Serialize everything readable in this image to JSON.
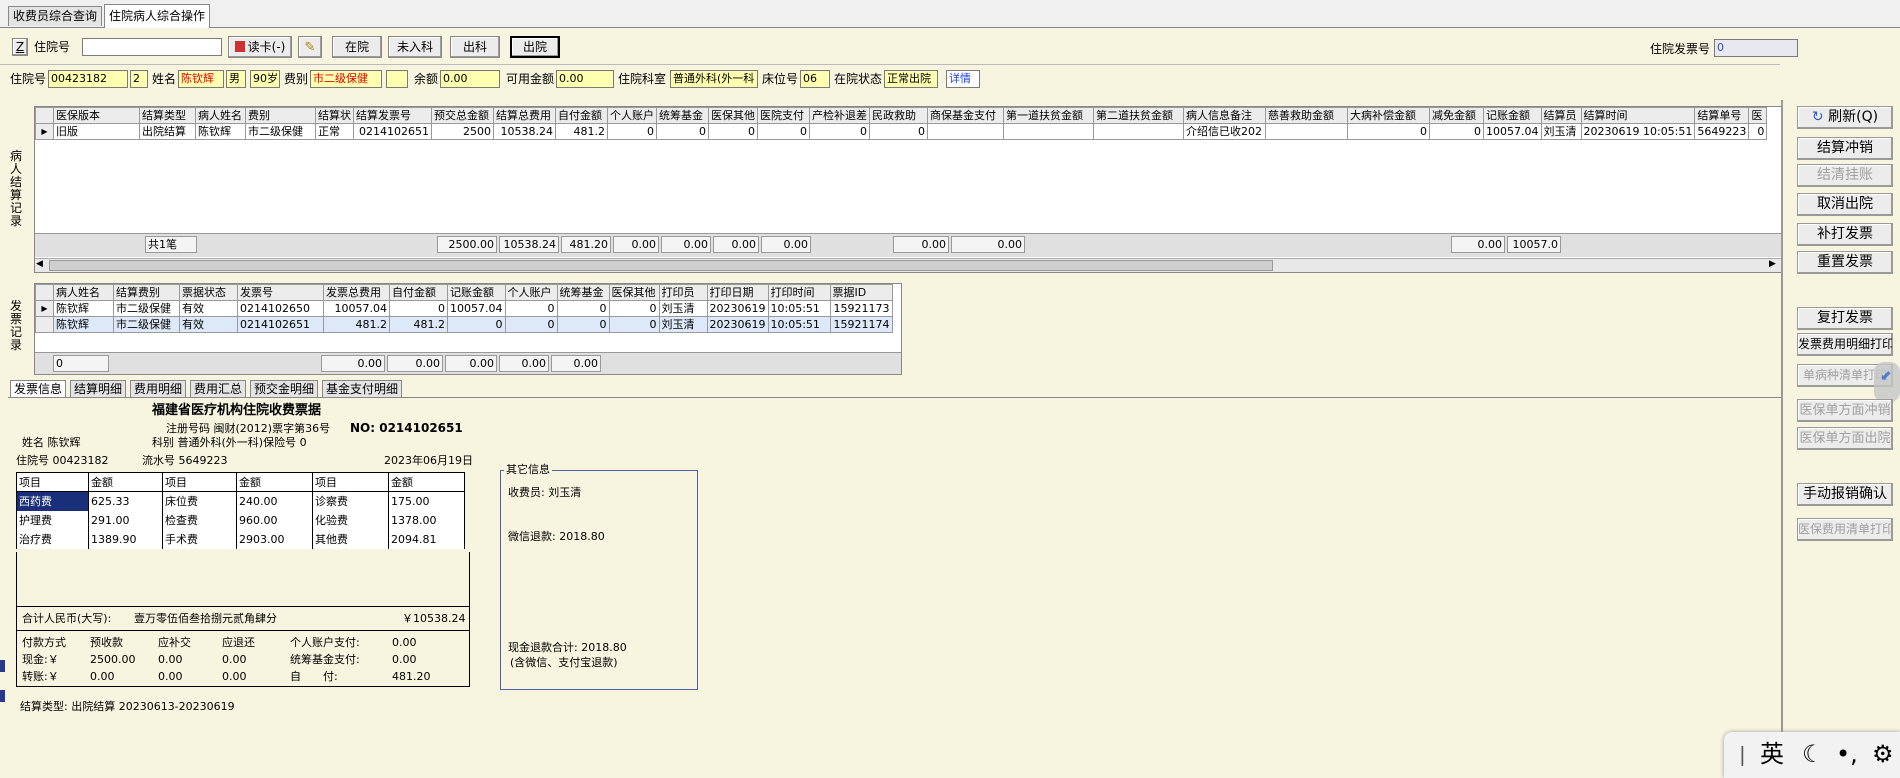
{
  "window_tabs": [
    "收费员综合查询",
    "住院病人综合操作"
  ],
  "search": {
    "toggle": "Z",
    "label": "住院号",
    "value": "",
    "read_card": "读卡(-)",
    "btn_in": "在院",
    "btn_notin": "未入科",
    "btn_out": "出科",
    "btn_discharge": "出院",
    "invoice_label": "住院发票号",
    "invoice_value": "0"
  },
  "patient": {
    "id_label": "住院号",
    "id": "00423182",
    "id_suffix": "2",
    "name_label": "姓名",
    "name": "陈钦辉",
    "sex": "男",
    "age": "90岁",
    "fee_label": "费别",
    "fee_type": "市二级保健",
    "balance_label": "余额",
    "balance": "0.00",
    "avail_label": "可用金额",
    "avail": "0.00",
    "dept_label": "住院科室",
    "dept": "普通外科(外一科",
    "bed_label": "床位号",
    "bed": "06",
    "status_label": "在院状态",
    "status": "正常出院",
    "detail": "详情"
  },
  "settle_label": "病人结算记录",
  "settle_cols": [
    "医保版本",
    "结算类型",
    "病人姓名",
    "费别",
    "结算状",
    "结算发票号",
    "预交总金额",
    "结算总费用",
    "自付金额",
    "个人账户",
    "统筹基金",
    "医保其他",
    "医院支付",
    "产检补退差",
    "民政救助",
    "商保基金支付",
    "第一道扶贫金额",
    "第二道扶贫金额",
    "病人信息备注",
    "慈善救助金额",
    "大病补偿金额",
    "减免金额",
    "记账金额",
    "结算员",
    "结算时间",
    "结算单号",
    "医"
  ],
  "settle_rows": [
    [
      "旧版",
      "出院结算",
      "陈钦辉",
      "市二级保健",
      "正常",
      "0214102651",
      "2500",
      "10538.24",
      "481.2",
      "0",
      "0",
      "0",
      "0",
      "0",
      "0",
      "",
      "",
      "",
      "介绍信已收202",
      "",
      "0",
      "0",
      "10057.04",
      "刘玉清",
      "20230619 10:05:51",
      "5649223",
      "0"
    ]
  ],
  "settle_sum": {
    "count": "共1笔",
    "deposit": "2500.00",
    "total": "10538.24",
    "self": "481.20",
    "personal": "0.00",
    "pooled": "0.00",
    "other": "0.00",
    "hospital": "0.00",
    "civil": "0.00",
    "commercial": "0.00",
    "reduce": "0.00",
    "account": "10057.0"
  },
  "invoice_label": "发票记录",
  "invoice_cols": [
    "病人姓名",
    "结算费别",
    "票据状态",
    "发票号",
    "发票总费用",
    "自付金额",
    "记账金额",
    "个人账户",
    "统筹基金",
    "医保其他",
    "打印员",
    "打印日期",
    "打印时间",
    "票据ID"
  ],
  "invoice_rows": [
    [
      "陈钦辉",
      "市二级保健",
      "有效",
      "0214102650",
      "10057.04",
      "0",
      "10057.04",
      "0",
      "0",
      "0",
      "刘玉清",
      "20230619",
      "10:05:51",
      "15921173"
    ],
    [
      "陈钦辉",
      "市二级保健",
      "有效",
      "0214102651",
      "481.2",
      "481.2",
      "0",
      "0",
      "0",
      "0",
      "刘玉清",
      "20230619",
      "10:05:51",
      "15921174"
    ]
  ],
  "invoice_sum": {
    "count": "0",
    "total": "0.00",
    "self": "0.00",
    "account": "0.00",
    "personal": "0.00",
    "pooled": "0.00"
  },
  "bottom_tabs": [
    "发票信息",
    "结算明细",
    "费用明细",
    "费用汇总",
    "预交金明细",
    "基金支付明细"
  ],
  "receipt": {
    "title": "福建省医疗机构住院收费票据",
    "reg": "注册号码 闽财(2012)票字第36号",
    "no": "NO: 0214102651",
    "name": "姓名 陈钦辉",
    "dept": "科别 普通外科(外一科)保险号 0",
    "inpatient": "住院号 00423182",
    "serial": "流水号 5649223",
    "date": "2023年06月19日",
    "item_head": [
      "项目",
      "金额",
      "项目",
      "金额",
      "项目",
      "金额"
    ],
    "items": [
      [
        "西药费",
        "625.33",
        "床位费",
        "240.00",
        "诊察费",
        "175.00"
      ],
      [
        "护理费",
        "291.00",
        "检查费",
        "960.00",
        "化验费",
        "1378.00"
      ],
      [
        "治疗费",
        "1389.90",
        "手术费",
        "2903.00",
        "其他费",
        "2094.81"
      ]
    ],
    "total_label": "合计人民币(大写):",
    "total_cn": "壹万零伍佰叁拾捌元贰角肆分",
    "total_num": "￥10538.24",
    "pay_head": [
      "付款方式",
      "预收款",
      "应补交",
      "应退还",
      "个人账户支付:",
      "0.00"
    ],
    "pay_rows": [
      [
        "现金:￥",
        "2500.00",
        "0.00",
        "0.00",
        "统筹基金支付:",
        "0.00"
      ],
      [
        "转账:￥",
        "0.00",
        "0.00",
        "0.00",
        "自　　付:",
        "481.20"
      ]
    ],
    "settle_type": "结算类型: 出院结算 20230613-20230619"
  },
  "other": {
    "title": "其它信息",
    "cashier": "收费员: 刘玉清",
    "wechat": "微信退款: 2018.80",
    "cash_total": "现金退款合计: 2018.80",
    "cash_note": "(含微信、支付宝退款)"
  },
  "right_buttons": {
    "refresh": "刷新(Q)",
    "reverse": "结算冲销",
    "clear": "结清挂账",
    "cancel": "取消出院",
    "reprint_inv": "补打发票",
    "reset": "重置发票",
    "re_reprint": "复打发票",
    "fee_detail": "发票费用明细打印",
    "disease": "单病种清单打印",
    "mi_reverse": "医保单方面冲销",
    "mi_discharge": "医保单方面出院",
    "manual": "手动报销确认",
    "mi_list": "医保费用清单打印"
  },
  "ime": {
    "lang": "英"
  }
}
